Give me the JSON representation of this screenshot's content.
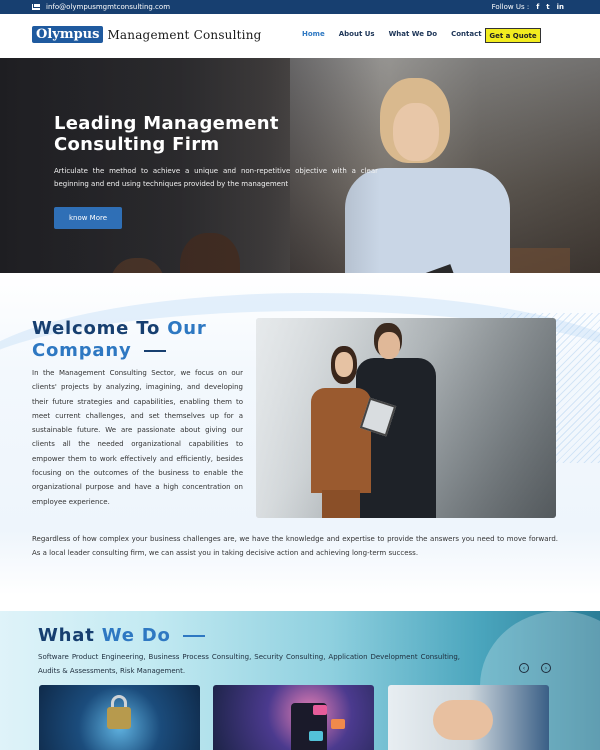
{
  "topbar": {
    "email": "info@olympusmgmtconsulting.com",
    "follow_label": "Follow Us :",
    "social": [
      {
        "icon": "facebook-icon",
        "glyph": "f"
      },
      {
        "icon": "twitter-icon",
        "glyph": "t"
      },
      {
        "icon": "linkedin-icon",
        "glyph": "in"
      }
    ]
  },
  "header": {
    "logo_primary": "Olympus",
    "logo_secondary": "Management Consulting",
    "nav": [
      "Home",
      "About Us",
      "What We Do",
      "Contact"
    ],
    "active_nav": "Home",
    "cta": "Get a Quote"
  },
  "hero": {
    "title": "Leading Management Consulting Firm",
    "text": "Articulate the method to achieve a unique and non-repetitive objective with a clear beginning and end using techniques provided by the management",
    "button": "know More"
  },
  "welcome": {
    "title_part1": "Welcome To ",
    "title_part2": "Our",
    "title_part3": "Company",
    "paragraph": "In the Management Consulting Sector, we focus on our clients' projects by analyzing, imagining, and developing their future strategies and capabilities, enabling them to meet current challenges, and set themselves up for a sustainable future. We are passionate about giving our clients all the needed organizational capabilities to empower them to work effectively and efficiently, besides focusing on the outcomes of the business to enable the organizational purpose and have a high concentration on employee experience.",
    "bottom_text": "Regardless of how complex your business challenges are, we have the knowledge and expertise to provide the answers you need to move forward. As a local leader consulting firm, we can assist you in taking decisive action and achieving long-term success."
  },
  "whatwedo": {
    "title_part1": "What ",
    "title_part2": "We Do",
    "text": "Software Product Engineering, Business Process Consulting, Security Consulting, Application Development Consulting, Audits & Assessments, Risk Management.",
    "prev_icon": "chevron-left-icon",
    "next_icon": "chevron-right-icon"
  },
  "colors": {
    "navy": "#173f70",
    "accent_blue": "#2e78c2",
    "cta_yellow": "#f2ec1f"
  }
}
